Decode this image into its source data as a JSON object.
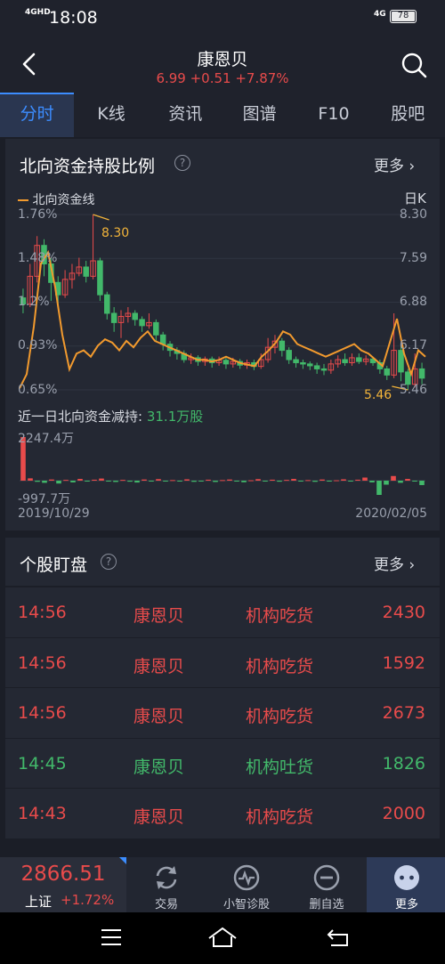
{
  "status_bar": {
    "network": "4G",
    "network_sub": "HD",
    "time": "18:08",
    "network_right": "4G",
    "battery": "78"
  },
  "header": {
    "title": "康恩贝",
    "quote": "6.99  +0.51  +7.87%",
    "back_icon": "chevron-left-icon",
    "search_icon": "search-icon"
  },
  "tabs": [
    "分时",
    "K线",
    "资讯",
    "图谱",
    "F10",
    "股吧"
  ],
  "active_tab": "分时",
  "north_card": {
    "title": "北向资金持股比例",
    "more": "更多",
    "legend": "北向资金线",
    "period": "日K",
    "left_ticks": [
      "1.76%",
      "1.48%",
      "1.2%",
      "0.93%",
      "0.65%"
    ],
    "right_ticks": [
      "8.30",
      "7.59",
      "6.88",
      "6.17",
      "5.46"
    ],
    "high_label": "8.30",
    "low_label": "5.46",
    "flow_label": "近一日北向资金减持:",
    "flow_value": "31.1万股",
    "bar_max": "2247.4万",
    "bar_min": "-997.7万",
    "date_start": "2019/10/29",
    "date_end": "2020/02/05"
  },
  "chart_data": {
    "type": "candlestick+line+bar",
    "price_range": [
      5.46,
      8.3
    ],
    "holding_range_pct": [
      0.65,
      1.76
    ],
    "x_range": [
      "2019/10/29",
      "2020/02/05"
    ],
    "candles": [
      {
        "o": 6.95,
        "c": 6.85,
        "h": 7.1,
        "l": 6.7
      },
      {
        "o": 6.85,
        "c": 7.3,
        "h": 7.5,
        "l": 6.8
      },
      {
        "o": 7.3,
        "c": 7.8,
        "h": 7.95,
        "l": 7.2
      },
      {
        "o": 7.8,
        "c": 7.5,
        "h": 7.9,
        "l": 7.3
      },
      {
        "o": 7.5,
        "c": 7.2,
        "h": 7.6,
        "l": 6.9
      },
      {
        "o": 7.2,
        "c": 7.0,
        "h": 7.3,
        "l": 6.85
      },
      {
        "o": 7.0,
        "c": 7.25,
        "h": 7.4,
        "l": 6.95
      },
      {
        "o": 7.25,
        "c": 7.35,
        "h": 7.5,
        "l": 7.1
      },
      {
        "o": 7.35,
        "c": 7.45,
        "h": 7.6,
        "l": 7.3
      },
      {
        "o": 7.45,
        "c": 7.3,
        "h": 7.55,
        "l": 7.2
      },
      {
        "o": 7.3,
        "c": 7.55,
        "h": 8.3,
        "l": 7.25
      },
      {
        "o": 7.55,
        "c": 7.0,
        "h": 7.6,
        "l": 6.9
      },
      {
        "o": 7.0,
        "c": 6.7,
        "h": 7.05,
        "l": 6.6
      },
      {
        "o": 6.7,
        "c": 6.55,
        "h": 6.8,
        "l": 6.4
      },
      {
        "o": 6.55,
        "c": 6.65,
        "h": 6.75,
        "l": 6.3
      },
      {
        "o": 6.65,
        "c": 6.7,
        "h": 6.8,
        "l": 6.55
      },
      {
        "o": 6.7,
        "c": 6.6,
        "h": 6.75,
        "l": 6.5
      },
      {
        "o": 6.6,
        "c": 6.5,
        "h": 6.65,
        "l": 6.4
      },
      {
        "o": 6.5,
        "c": 6.55,
        "h": 6.7,
        "l": 6.45
      },
      {
        "o": 6.55,
        "c": 6.35,
        "h": 6.6,
        "l": 6.25
      },
      {
        "o": 6.35,
        "c": 6.2,
        "h": 6.4,
        "l": 6.1
      },
      {
        "o": 6.2,
        "c": 6.1,
        "h": 6.25,
        "l": 6.0
      },
      {
        "o": 6.1,
        "c": 6.05,
        "h": 6.15,
        "l": 5.95
      },
      {
        "o": 6.05,
        "c": 5.95,
        "h": 6.1,
        "l": 5.9
      },
      {
        "o": 5.95,
        "c": 5.98,
        "h": 6.05,
        "l": 5.88
      },
      {
        "o": 5.98,
        "c": 5.92,
        "h": 6.02,
        "l": 5.85
      },
      {
        "o": 5.92,
        "c": 5.96,
        "h": 6.0,
        "l": 5.85
      },
      {
        "o": 5.96,
        "c": 5.9,
        "h": 6.0,
        "l": 5.82
      },
      {
        "o": 5.9,
        "c": 5.94,
        "h": 6.0,
        "l": 5.85
      },
      {
        "o": 5.94,
        "c": 5.88,
        "h": 5.98,
        "l": 5.8
      },
      {
        "o": 5.88,
        "c": 5.92,
        "h": 5.98,
        "l": 5.82
      },
      {
        "o": 5.92,
        "c": 5.86,
        "h": 5.96,
        "l": 5.8
      },
      {
        "o": 5.86,
        "c": 5.9,
        "h": 5.95,
        "l": 5.8
      },
      {
        "o": 5.9,
        "c": 5.84,
        "h": 5.95,
        "l": 5.78
      },
      {
        "o": 5.84,
        "c": 5.95,
        "h": 6.05,
        "l": 5.8
      },
      {
        "o": 5.95,
        "c": 6.15,
        "h": 6.3,
        "l": 5.9
      },
      {
        "o": 6.15,
        "c": 6.25,
        "h": 6.35,
        "l": 6.05
      },
      {
        "o": 6.25,
        "c": 6.1,
        "h": 6.3,
        "l": 6.0
      },
      {
        "o": 6.1,
        "c": 5.95,
        "h": 6.15,
        "l": 5.88
      },
      {
        "o": 5.95,
        "c": 5.9,
        "h": 6.0,
        "l": 5.82
      },
      {
        "o": 5.9,
        "c": 5.88,
        "h": 5.95,
        "l": 5.8
      },
      {
        "o": 5.88,
        "c": 5.85,
        "h": 5.92,
        "l": 5.78
      },
      {
        "o": 5.85,
        "c": 5.8,
        "h": 5.9,
        "l": 5.72
      },
      {
        "o": 5.8,
        "c": 5.78,
        "h": 5.88,
        "l": 5.7
      },
      {
        "o": 5.78,
        "c": 5.88,
        "h": 5.95,
        "l": 5.72
      },
      {
        "o": 5.88,
        "c": 5.95,
        "h": 6.02,
        "l": 5.82
      },
      {
        "o": 5.95,
        "c": 5.9,
        "h": 6.05,
        "l": 5.85
      },
      {
        "o": 5.9,
        "c": 5.98,
        "h": 6.05,
        "l": 5.85
      },
      {
        "o": 5.98,
        "c": 5.92,
        "h": 6.05,
        "l": 5.88
      },
      {
        "o": 5.92,
        "c": 5.96,
        "h": 6.02,
        "l": 5.86
      },
      {
        "o": 5.96,
        "c": 5.9,
        "h": 6.0,
        "l": 5.85
      },
      {
        "o": 5.9,
        "c": 5.8,
        "h": 5.95,
        "l": 5.72
      },
      {
        "o": 5.8,
        "c": 5.7,
        "h": 5.85,
        "l": 5.62
      },
      {
        "o": 5.7,
        "c": 6.1,
        "h": 6.7,
        "l": 5.65
      },
      {
        "o": 6.1,
        "c": 5.75,
        "h": 6.2,
        "l": 5.6
      },
      {
        "o": 5.75,
        "c": 5.55,
        "h": 5.8,
        "l": 5.46
      },
      {
        "o": 5.55,
        "c": 5.8,
        "h": 6.05,
        "l": 5.5
      },
      {
        "o": 5.8,
        "c": 5.65,
        "h": 5.9,
        "l": 5.55
      }
    ],
    "holding_line_pct": [
      0.66,
      0.75,
      1.05,
      1.45,
      1.52,
      1.3,
      1.0,
      0.78,
      0.88,
      0.9,
      0.86,
      0.93,
      0.97,
      0.95,
      0.9,
      0.96,
      0.92,
      0.98,
      1.02,
      0.96,
      0.94,
      0.92,
      0.9,
      0.88,
      0.86,
      0.84,
      0.84,
      0.83,
      0.84,
      0.86,
      0.84,
      0.82,
      0.81,
      0.8,
      0.86,
      0.9,
      0.95,
      1.02,
      1.0,
      0.94,
      0.92,
      0.9,
      0.88,
      0.86,
      0.88,
      0.9,
      0.92,
      0.94,
      0.9,
      0.88,
      0.84,
      0.8,
      0.95,
      1.1,
      0.88,
      0.75,
      0.9,
      0.86
    ],
    "flow_bars_wan": [
      2247.4,
      120,
      -80,
      -150,
      60,
      -200,
      40,
      -120,
      90,
      -60,
      50,
      110,
      -30,
      -90,
      40,
      -70,
      -130,
      60,
      -50,
      80,
      -40,
      30,
      -60,
      70,
      -80,
      -20,
      50,
      -90,
      30,
      60,
      -40,
      -110,
      20,
      80,
      -30,
      50,
      -70,
      40,
      90,
      -50,
      30,
      -80,
      60,
      -40,
      20,
      70,
      -30,
      50,
      160,
      -120,
      -997.7,
      -280,
      240,
      -150,
      90,
      -60,
      -310
    ]
  },
  "picks_card": {
    "title": "个股盯盘",
    "more": "更多",
    "rows": [
      {
        "time": "14:56",
        "name": "康恩贝",
        "event": "机构吃货",
        "volume": "2430",
        "tone": "up"
      },
      {
        "time": "14:56",
        "name": "康恩贝",
        "event": "机构吃货",
        "volume": "1592",
        "tone": "up"
      },
      {
        "time": "14:56",
        "name": "康恩贝",
        "event": "机构吃货",
        "volume": "2673",
        "tone": "up"
      },
      {
        "time": "14:45",
        "name": "康恩贝",
        "event": "机构吐货",
        "volume": "1826",
        "tone": "down"
      },
      {
        "time": "14:43",
        "name": "康恩贝",
        "event": "机构吃货",
        "volume": "2000",
        "tone": "up"
      }
    ]
  },
  "bottom_nav": {
    "index_value": "2866.51",
    "index_name": "上证",
    "index_change": "+1.72%",
    "items": [
      {
        "label": "交易",
        "icon": "trade-cycle-icon"
      },
      {
        "label": "小智诊股",
        "icon": "pulse-diagnosis-icon"
      },
      {
        "label": "删自选",
        "icon": "remove-watchlist-icon"
      },
      {
        "label": "更多",
        "icon": "more-dots-icon"
      }
    ]
  },
  "colors": {
    "up": "#e84b4b",
    "down": "#42b86a",
    "accent": "#3c8dff",
    "line": "#f29a2e"
  },
  "system_nav": {
    "menu_icon": "menu-icon",
    "home_icon": "home-icon",
    "back_icon": "back-icon"
  }
}
